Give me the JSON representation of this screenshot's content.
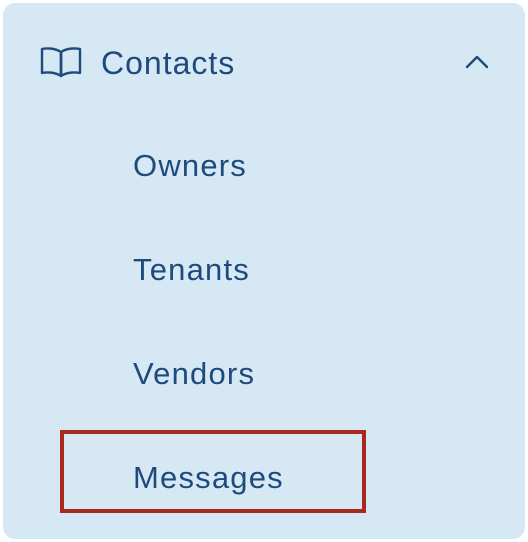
{
  "colors": {
    "panel_background": "#d7e8f5",
    "text": "#1e4a7c",
    "highlight_border": "#a8291e"
  },
  "menu": {
    "header": {
      "label": "Contacts",
      "icon": "book-icon",
      "expand_icon": "chevron-up-icon",
      "expanded": true
    },
    "items": [
      {
        "label": "Owners"
      },
      {
        "label": "Tenants"
      },
      {
        "label": "Vendors"
      },
      {
        "label": "Messages",
        "highlighted": true
      }
    ]
  }
}
